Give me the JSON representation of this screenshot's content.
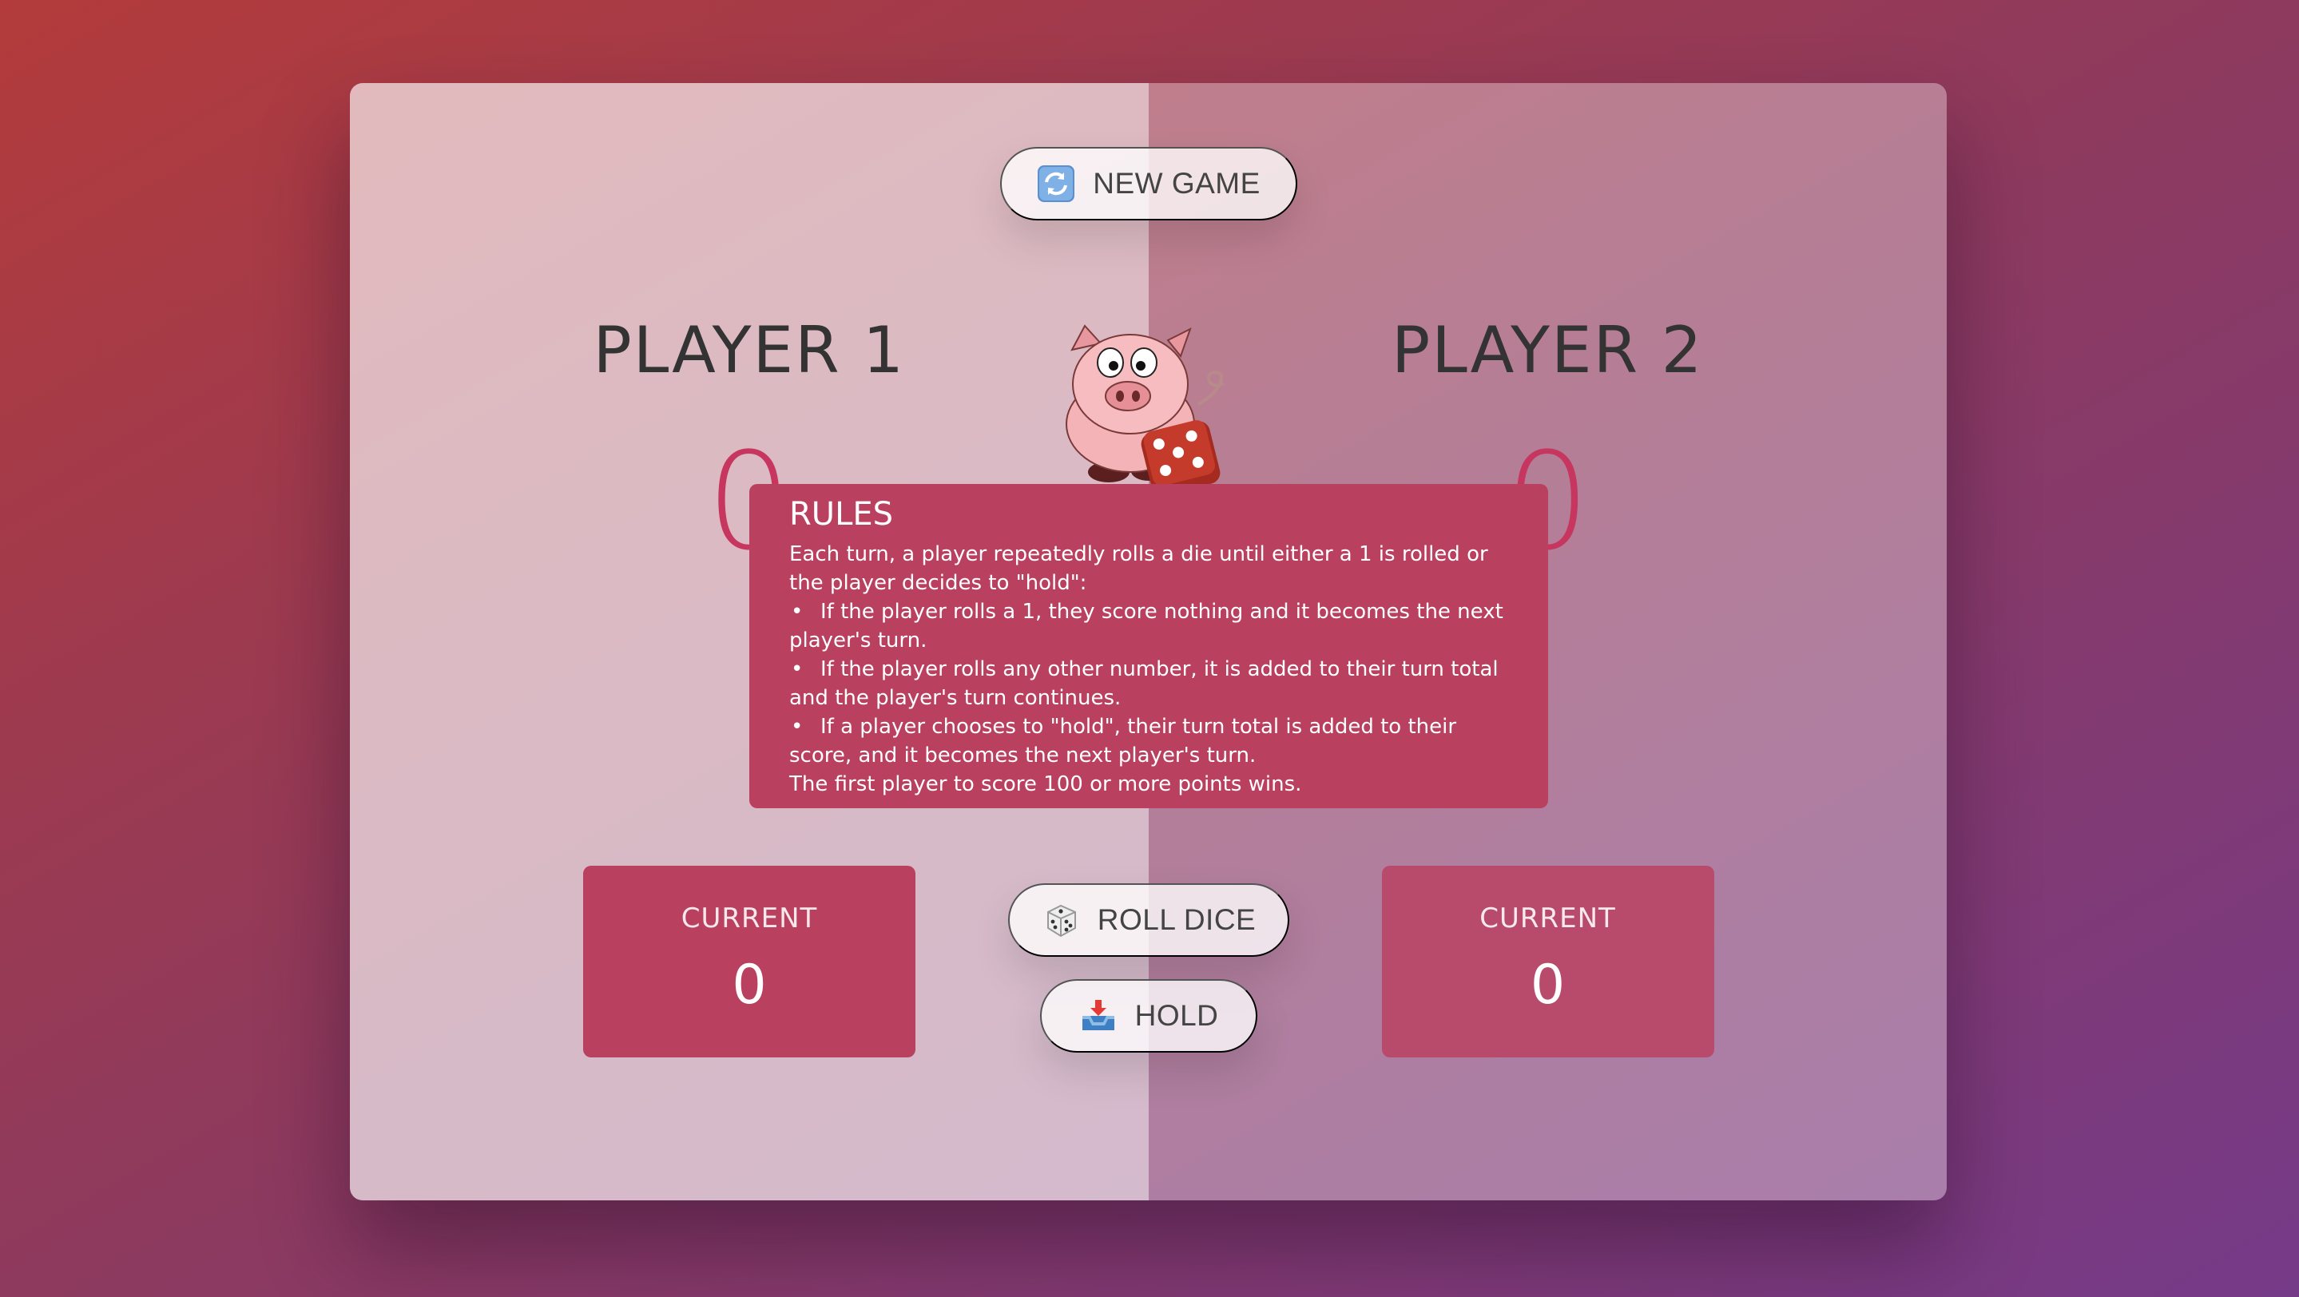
{
  "players": [
    {
      "name": "PLAYER 1",
      "score": "0",
      "current_label": "CURRENT",
      "current_score": "0"
    },
    {
      "name": "PLAYER 2",
      "score": "0",
      "current_label": "CURRENT",
      "current_score": "0"
    }
  ],
  "buttons": {
    "new_game": {
      "label": "NEW GAME",
      "icon": "refresh-icon"
    },
    "roll_dice": {
      "label": "ROLL DICE",
      "icon": "dice-icon"
    },
    "hold": {
      "label": "HOLD",
      "icon": "inbox-tray-icon"
    }
  },
  "rules": {
    "title": "RULES",
    "intro": "Each turn, a player repeatedly rolls a die until either a 1 is rolled or the player decides to \"hold\":",
    "items": [
      "If the player rolls a 1, they score nothing and it becomes the next player's turn.",
      "If the player rolls any other number, it is added to their turn total and the player's turn continues.",
      "If a player chooses to \"hold\", their turn total is added to their score, and it becomes the next player's turn."
    ],
    "outro": "The first player to score 100 or more points wins."
  },
  "colors": {
    "accent": "#c7365f",
    "panel": "#b9405f",
    "bg_start": "#b33b3b",
    "bg_end": "#753a88"
  },
  "active_player": 1
}
